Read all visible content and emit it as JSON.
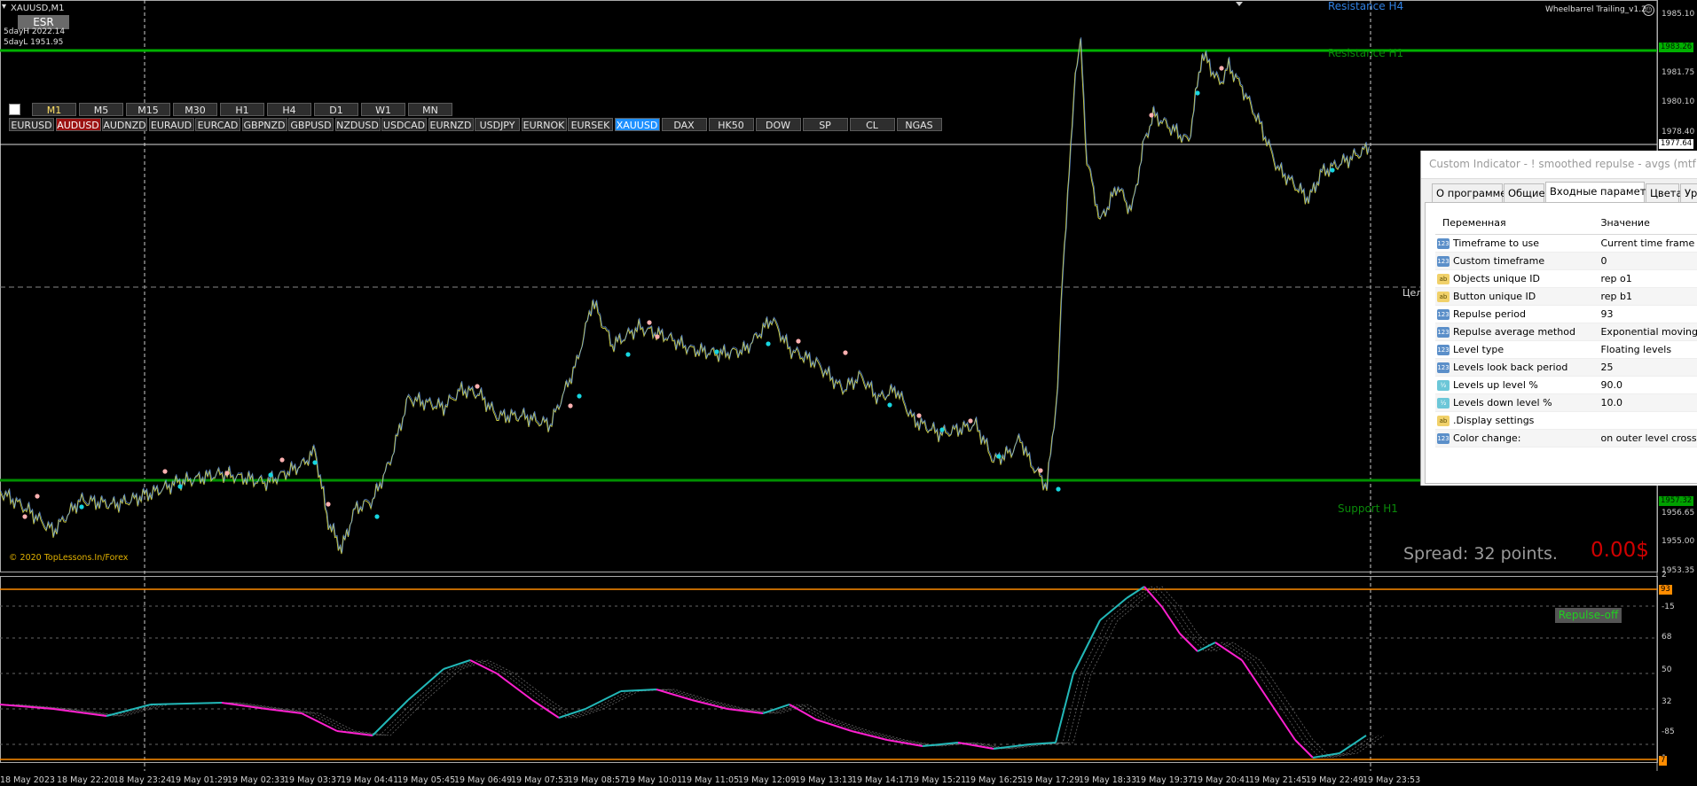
{
  "window": {
    "symbol_title": "XAUUSD,M1",
    "esr_label": "ESR",
    "day_high": "5dayH 2022.14",
    "day_low": "5dayL 1951.95"
  },
  "ea_label": "Wheelbarrel Trailing_v1.2",
  "copyright": "© 2020 TopLessons.In/Forex",
  "timeframes": [
    {
      "label": "M1",
      "active": true
    },
    {
      "label": "M5",
      "active": false
    },
    {
      "label": "M15",
      "active": false
    },
    {
      "label": "M30",
      "active": false
    },
    {
      "label": "H1",
      "active": false
    },
    {
      "label": "H4",
      "active": false
    },
    {
      "label": "D1",
      "active": false
    },
    {
      "label": "W1",
      "active": false
    },
    {
      "label": "MN",
      "active": false
    }
  ],
  "symbols": [
    {
      "label": "EURUSD",
      "state": "normal"
    },
    {
      "label": "AUDUSD",
      "state": "red"
    },
    {
      "label": "AUDNZD",
      "state": "normal"
    },
    {
      "label": "EURAUD",
      "state": "normal"
    },
    {
      "label": "EURCAD",
      "state": "normal"
    },
    {
      "label": "GBPNZD",
      "state": "normal"
    },
    {
      "label": "GBPUSD",
      "state": "normal"
    },
    {
      "label": "NZDUSD",
      "state": "normal"
    },
    {
      "label": "USDCAD",
      "state": "normal"
    },
    {
      "label": "EURNZD",
      "state": "normal"
    },
    {
      "label": "USDJPY",
      "state": "normal"
    },
    {
      "label": "EURNOK",
      "state": "normal"
    },
    {
      "label": "EURSEK",
      "state": "normal"
    },
    {
      "label": "XAUUSD",
      "state": "blue"
    },
    {
      "label": "DAX",
      "state": "normal"
    },
    {
      "label": "HK50",
      "state": "normal"
    },
    {
      "label": "DOW",
      "state": "normal"
    },
    {
      "label": "SP",
      "state": "normal"
    },
    {
      "label": "CL",
      "state": "normal"
    },
    {
      "label": "NGAS",
      "state": "normal"
    }
  ],
  "levels": {
    "resistance_h4": "Resistance H4",
    "resistance_h1": "Resistance H1",
    "target": "Цель",
    "support_h1": "Support H1"
  },
  "spread_text": "Spread: 32 points.",
  "profit_text": "0.00$",
  "repulse_button": "Repulse-off",
  "price_axis": [
    {
      "label": "1985.10",
      "price": 1985.1
    },
    {
      "label": "1981.75",
      "price": 1981.75
    },
    {
      "label": "1980.10",
      "price": 1980.1
    },
    {
      "label": "1978.40",
      "price": 1978.4
    },
    {
      "label": "1956.65",
      "price": 1956.65
    },
    {
      "label": "1955.00",
      "price": 1955.0
    },
    {
      "label": "1953.35",
      "price": 1953.35
    }
  ],
  "price_tags": {
    "resistance": "1983.26",
    "current": "1977.64",
    "support": "1957.32"
  },
  "indicator_axis": [
    {
      "label": "2",
      "v": 103
    },
    {
      "label": "-15",
      "v": 85
    },
    {
      "label": "68",
      "v": 68
    },
    {
      "label": "50",
      "v": 50
    },
    {
      "label": "32",
      "v": 32
    },
    {
      "label": "-85",
      "v": 15
    },
    {
      "label": "1",
      "v": 0
    }
  ],
  "indicator_tags": {
    "upper": "93",
    "lower": "7"
  },
  "time_axis": [
    "18 May 2023",
    "18 May 22:20",
    "18 May 23:24",
    "19 May 01:29",
    "19 May 02:33",
    "19 May 03:37",
    "19 May 04:41",
    "19 May 05:45",
    "19 May 06:49",
    "19 May 07:53",
    "19 May 08:57",
    "19 May 10:01",
    "19 May 11:05",
    "19 May 12:09",
    "19 May 13:13",
    "19 May 14:17",
    "19 May 15:21",
    "19 May 16:25",
    "19 May 17:29",
    "19 May 18:33",
    "19 May 19:37",
    "19 May 20:41",
    "19 May 21:45",
    "19 May 22:49",
    "19 May 23:53"
  ],
  "colors": {
    "background": "#000000",
    "resistance_line": "#00b000",
    "support_line": "#009000",
    "price_line_up": "#6fa8ff",
    "price_line_down": "#c8c840",
    "repulse_up": "#22b8b8",
    "repulse_down": "#ff20d0",
    "upper_level": "#ff8c00",
    "spread_text": "#9a9a9a",
    "profit_text": "#d00000"
  },
  "dialog": {
    "title": "Custom Indicator - ! smoothed repulse - avgs (mtf + alerts)",
    "tabs": [
      {
        "label": "О программе",
        "selected": false
      },
      {
        "label": "Общие",
        "selected": false
      },
      {
        "label": "Входные параметры",
        "selected": true
      },
      {
        "label": "Цвета",
        "selected": false
      },
      {
        "label": "Ур",
        "selected": false
      }
    ],
    "col_variable": "Переменная",
    "col_value": "Значение",
    "params": [
      {
        "icon": "int-icon",
        "icon_text": "123",
        "name": "Timeframe to use",
        "value": "Current time frame"
      },
      {
        "icon": "int-icon",
        "icon_text": "123",
        "name": "Custom timeframe",
        "value": "0"
      },
      {
        "icon": "string-icon",
        "icon_text": "ab",
        "name": "Objects unique ID",
        "value": "rep o1"
      },
      {
        "icon": "string-icon",
        "icon_text": "ab",
        "name": "Button unique ID",
        "value": "rep b1"
      },
      {
        "icon": "int-icon",
        "icon_text": "123",
        "name": "Repulse period",
        "value": "93"
      },
      {
        "icon": "int-icon",
        "icon_text": "123",
        "name": "Repulse average method",
        "value": "Exponential moving"
      },
      {
        "icon": "int-icon",
        "icon_text": "123",
        "name": "Level type",
        "value": "Floating levels"
      },
      {
        "icon": "int-icon",
        "icon_text": "123",
        "name": "Levels look back period",
        "value": "25"
      },
      {
        "icon": "double-icon",
        "icon_text": "½",
        "name": "Levels up level %",
        "value": "90.0"
      },
      {
        "icon": "double-icon",
        "icon_text": "½",
        "name": "Levels down level %",
        "value": "10.0"
      },
      {
        "icon": "string-icon",
        "icon_text": "ab",
        "name": ".Display settings",
        "value": ""
      },
      {
        "icon": "int-icon",
        "icon_text": "123",
        "name": "Color change:",
        "value": "on outer level cross"
      }
    ]
  }
}
